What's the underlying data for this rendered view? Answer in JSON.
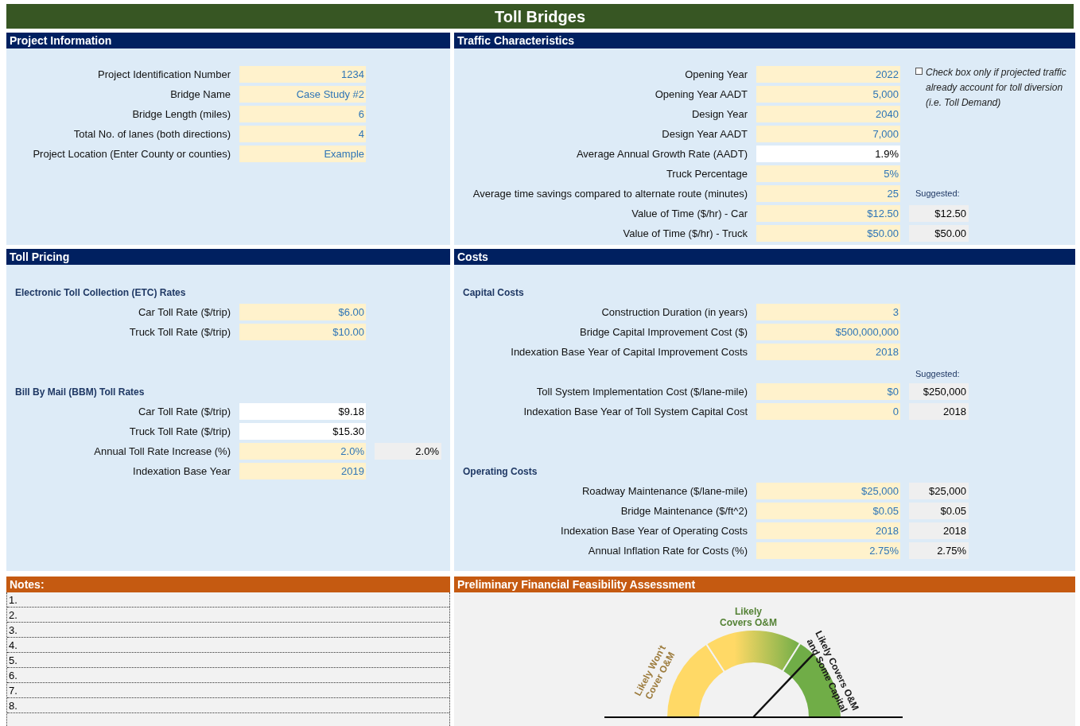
{
  "title": "Toll Bridges",
  "project_information": {
    "title": "Project Information",
    "lines": [
      {
        "kind": "input",
        "label": "Project Identification Number",
        "value": "1234"
      },
      {
        "kind": "input",
        "label": "Bridge Name",
        "value": "Case Study #2"
      },
      {
        "kind": "input",
        "label": "Bridge Length (miles)",
        "value": "6"
      },
      {
        "kind": "input",
        "label": "Total No. of lanes (both directions)",
        "value": "4"
      },
      {
        "kind": "input",
        "label": "Project Location (Enter County or counties)",
        "value": "Example"
      }
    ]
  },
  "traffic_characteristics": {
    "title": "Traffic Characteristics",
    "checkbox": {
      "label": "Check box only if projected traffic already account for toll diversion (i.e. Toll Demand)",
      "checked": false
    },
    "lines": [
      {
        "kind": "input",
        "label": "Opening Year",
        "value": "2022"
      },
      {
        "kind": "input",
        "label": "Opening Year AADT",
        "value": "5,000"
      },
      {
        "kind": "input",
        "label": "Design Year",
        "value": "2040"
      },
      {
        "kind": "input",
        "label": "Design Year AADT",
        "value": "7,000"
      },
      {
        "kind": "calc",
        "label": "Average Annual Growth Rate (AADT)",
        "value": "1.9%"
      },
      {
        "kind": "input",
        "label": "Truck Percentage",
        "value": "5%"
      },
      {
        "kind": "input",
        "label": "Average time savings compared to alternate route (minutes)",
        "value": "25",
        "side_label": "Suggested:"
      },
      {
        "kind": "input",
        "label": "Value of Time ($/hr) - Car",
        "value": "$12.50",
        "suggested": "$12.50"
      },
      {
        "kind": "input",
        "label": "Value of Time ($/hr) - Truck",
        "value": "$50.00",
        "suggested": "$50.00"
      }
    ]
  },
  "toll_pricing": {
    "title": "Toll Pricing",
    "lines": [
      {
        "kind": "heading",
        "label": "Electronic Toll Collection (ETC) Rates"
      },
      {
        "kind": "input",
        "label": "Car Toll Rate ($/trip)",
        "value": "$6.00"
      },
      {
        "kind": "input",
        "label": "Truck Toll Rate ($/trip)",
        "value": "$10.00"
      },
      {
        "kind": "spacer"
      },
      {
        "kind": "spacer"
      },
      {
        "kind": "heading",
        "label": "Bill By Mail (BBM) Toll Rates"
      },
      {
        "kind": "calc",
        "label": "Car Toll Rate ($/trip)",
        "value": "$9.18"
      },
      {
        "kind": "calc",
        "label": "Truck Toll Rate ($/trip)",
        "value": "$15.30"
      },
      {
        "kind": "input",
        "label": "Annual Toll Rate Increase (%)",
        "value": "2.0%",
        "suggested": "2.0%"
      },
      {
        "kind": "input",
        "label": "Indexation Base Year",
        "value": "2019"
      }
    ]
  },
  "costs": {
    "title": "Costs",
    "lines": [
      {
        "kind": "heading",
        "label": "Capital Costs"
      },
      {
        "kind": "input",
        "label": "Construction Duration (in years)",
        "value": "3"
      },
      {
        "kind": "input",
        "label": "Bridge Capital Improvement Cost ($)",
        "value": "$500,000,000"
      },
      {
        "kind": "input",
        "label": "Indexation Base Year of Capital Improvement Costs",
        "value": "2018"
      },
      {
        "kind": "caption",
        "label": "Suggested:"
      },
      {
        "kind": "input",
        "label": "Toll System Implementation Cost ($/lane-mile)",
        "value": "$0",
        "suggested": "$250,000"
      },
      {
        "kind": "input",
        "label": "Indexation Base Year of Toll System Capital Cost",
        "value": "0",
        "suggested": "2018"
      },
      {
        "kind": "spacer"
      },
      {
        "kind": "spacer"
      },
      {
        "kind": "heading",
        "label": "Operating Costs"
      },
      {
        "kind": "input",
        "label": "Roadway Maintenance ($/lane-mile)",
        "value": "$25,000",
        "suggested": "$25,000"
      },
      {
        "kind": "input",
        "label": "Bridge Maintenance ($/ft^2)",
        "value": "$0.05",
        "suggested": "$0.05"
      },
      {
        "kind": "input",
        "label": "Indexation Base Year of Operating Costs",
        "value": "2018",
        "suggested": "2018"
      },
      {
        "kind": "input",
        "label": "Annual Inflation Rate for Costs (%)",
        "value": "2.75%",
        "suggested": "2.75%"
      }
    ]
  },
  "notes": {
    "title": "Notes:",
    "items": [
      "1.",
      "2.",
      "3.",
      "4.",
      "5.",
      "6.",
      "7.",
      "8."
    ]
  },
  "assessment": {
    "title": "Preliminary Financial Feasibility Assessment",
    "gauge": {
      "level": 0.74,
      "labels": [
        {
          "kind": "left",
          "lines": [
            "Likely Won't",
            "Cover O&M"
          ]
        },
        {
          "kind": "top",
          "lines": [
            "Likely",
            "Covers O&M"
          ]
        },
        {
          "kind": "right",
          "lines": [
            "Likely Covers O&M",
            "and Some Capital"
          ]
        }
      ]
    }
  }
}
